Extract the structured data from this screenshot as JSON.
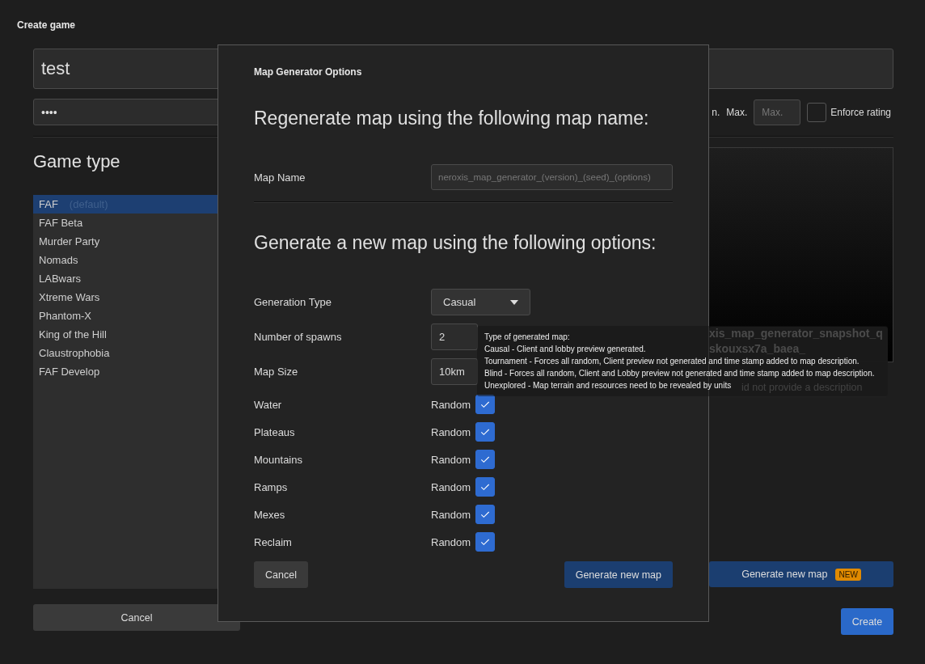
{
  "window": {
    "title": "Create game"
  },
  "title_field": {
    "value": "test"
  },
  "password_field": {
    "value": "••••"
  },
  "rating": {
    "min_label": "n.",
    "max_label": "Max.",
    "max_placeholder": "Max.",
    "enforce": {
      "label": "Enforce rating",
      "checked": false
    }
  },
  "game_type": {
    "heading": "Game type",
    "items": [
      {
        "label": "FAF",
        "hint": "(default)",
        "selected": true
      },
      {
        "label": "FAF Beta",
        "selected": false
      },
      {
        "label": "Murder Party",
        "selected": false
      },
      {
        "label": "Nomads",
        "selected": false
      },
      {
        "label": "LABwars",
        "selected": false
      },
      {
        "label": "Xtreme Wars",
        "selected": false
      },
      {
        "label": "Phantom-X",
        "selected": false
      },
      {
        "label": "King of the Hill",
        "selected": false
      },
      {
        "label": "Claustrophobia",
        "selected": false
      },
      {
        "label": "FAF Develop",
        "selected": false
      }
    ]
  },
  "cancel_button": "Cancel",
  "map_preview": {
    "name_lines": [
      "xis_map_generator_snapshot_q",
      "skouxsx7a_baea_"
    ],
    "description": "id not provide a description"
  },
  "generate_button": {
    "label": "Generate new map",
    "badge": "NEW"
  },
  "create_button": "Create",
  "dialog": {
    "title": "Map Generator Options",
    "regenerate_heading": "Regenerate map using the following map name:",
    "map_name": {
      "label": "Map Name",
      "placeholder": "neroxis_map_generator_(version)_(seed)_(options)"
    },
    "generate_heading": "Generate a new map using the following options:",
    "options": [
      {
        "kind": "select",
        "label": "Generation Type",
        "value": "Casual"
      },
      {
        "kind": "spinner",
        "label": "Number of spawns",
        "value": "2"
      },
      {
        "kind": "spinner",
        "label": "Map Size",
        "value": "10km"
      },
      {
        "kind": "random",
        "label": "Water",
        "text": "Random",
        "checked": true
      },
      {
        "kind": "random",
        "label": "Plateaus",
        "text": "Random",
        "checked": true
      },
      {
        "kind": "random",
        "label": "Mountains",
        "text": "Random",
        "checked": true
      },
      {
        "kind": "random",
        "label": "Ramps",
        "text": "Random",
        "checked": true
      },
      {
        "kind": "random",
        "label": "Mexes",
        "text": "Random",
        "checked": true
      },
      {
        "kind": "random",
        "label": "Reclaim",
        "text": "Random",
        "checked": true
      }
    ],
    "cancel_button": "Cancel",
    "generate_button": "Generate new map"
  },
  "tooltip": {
    "lines": [
      "Type of generated map:",
      "Causal - Client and lobby preview generated.",
      "Tournament - Forces all random, Client preview not generated and time stamp added to map description.",
      "Blind - Forces all random, Client and Lobby preview not generated and time stamp added to map description.",
      "Unexplored - Map terrain and resources need to be revealed by units"
    ]
  }
}
